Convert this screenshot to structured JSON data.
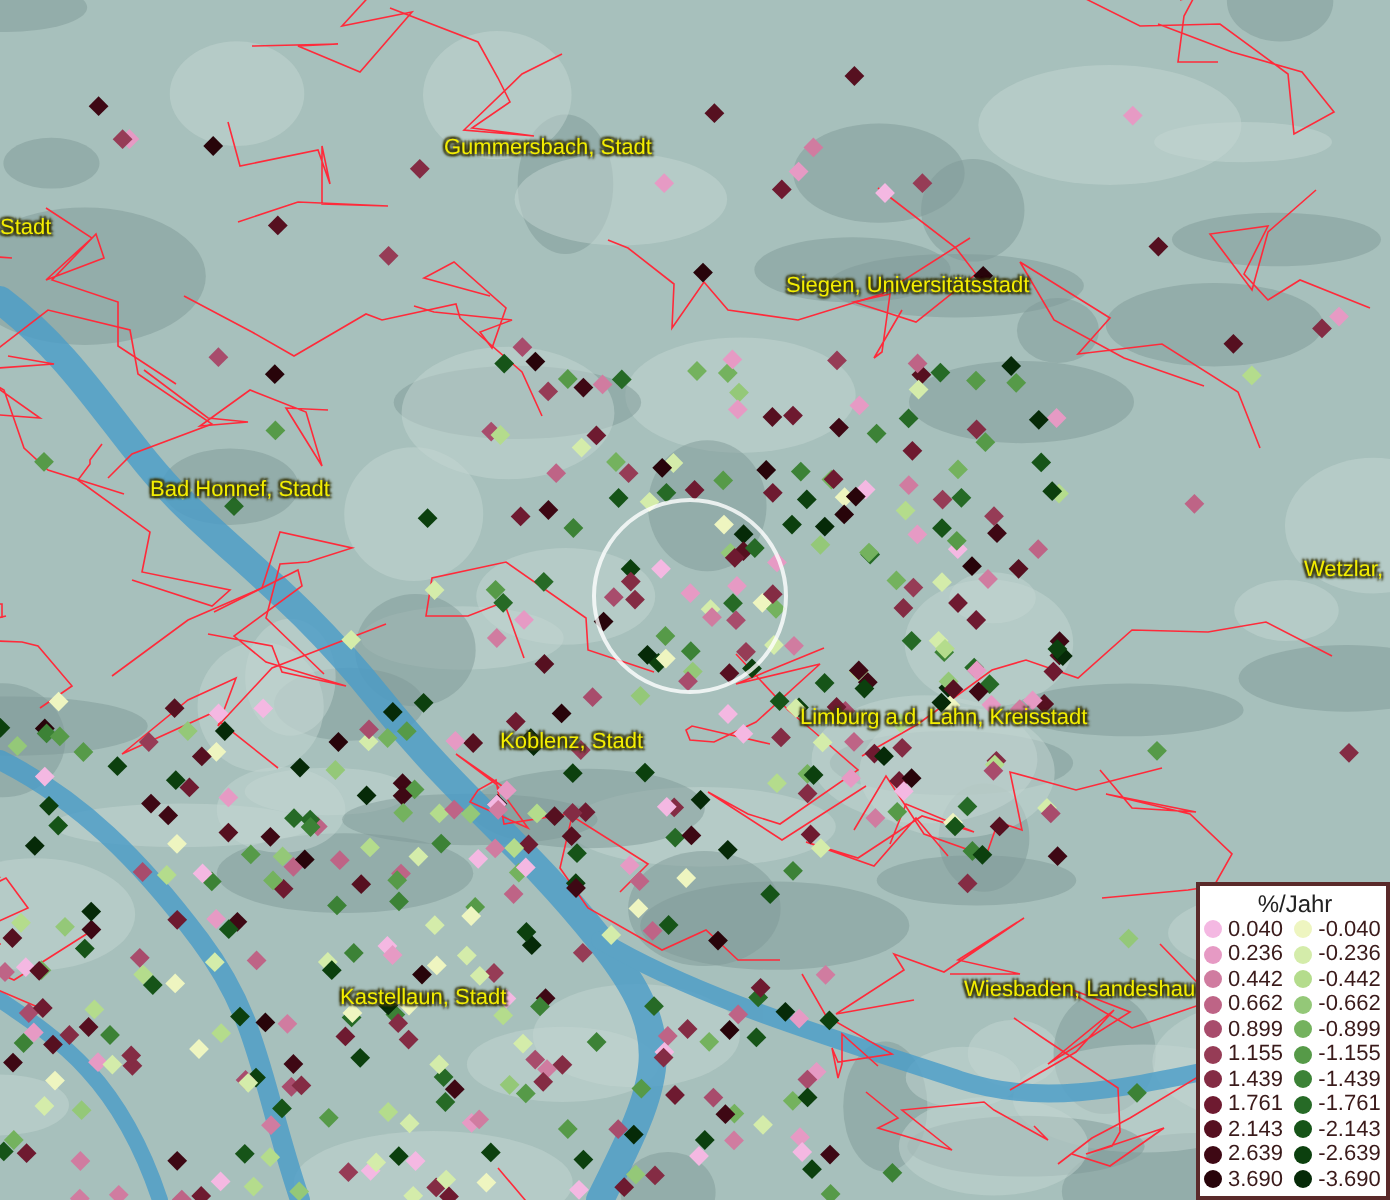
{
  "map": {
    "place_labels": [
      {
        "text": "Gummersbach, Stadt"
      },
      {
        "text": "Stadt"
      },
      {
        "text": "Siegen, Universitätsstadt"
      },
      {
        "text": "Bad Honnef, Stadt"
      },
      {
        "text": "Wetzlar,"
      },
      {
        "text": "Limburg a.d. Lahn, Kreisstadt"
      },
      {
        "text": "Koblenz, Stadt"
      },
      {
        "text": "Kastellaun, Stadt"
      },
      {
        "text": "Wiesbaden, Landeshau"
      }
    ]
  },
  "legend": {
    "title": "%/Jahr",
    "positive": [
      {
        "value": "0.040",
        "color": "#f4b8e2"
      },
      {
        "value": "0.236",
        "color": "#e69ac4"
      },
      {
        "value": "0.442",
        "color": "#d07ca0"
      },
      {
        "value": "0.662",
        "color": "#be6486"
      },
      {
        "value": "0.899",
        "color": "#a84c6c"
      },
      {
        "value": "1.155",
        "color": "#963c56"
      },
      {
        "value": "1.439",
        "color": "#842c44"
      },
      {
        "value": "1.761",
        "color": "#6e1a30"
      },
      {
        "value": "2.143",
        "color": "#561020"
      },
      {
        "value": "2.639",
        "color": "#3e0814"
      },
      {
        "value": "3.690",
        "color": "#28040a"
      }
    ],
    "negative": [
      {
        "value": "-0.040",
        "color": "#eef5c0"
      },
      {
        "value": "-0.236",
        "color": "#d4ecaa"
      },
      {
        "value": "-0.442",
        "color": "#b4dc8c"
      },
      {
        "value": "-0.662",
        "color": "#94c878"
      },
      {
        "value": "-0.899",
        "color": "#74b25e"
      },
      {
        "value": "-1.155",
        "color": "#569a48"
      },
      {
        "value": "-1.439",
        "color": "#3c8236"
      },
      {
        "value": "-1.761",
        "color": "#266a26"
      },
      {
        "value": "-2.143",
        "color": "#165418"
      },
      {
        "value": "-2.639",
        "color": "#0c400e"
      },
      {
        "value": "-3.690",
        "color": "#062a08"
      }
    ]
  }
}
